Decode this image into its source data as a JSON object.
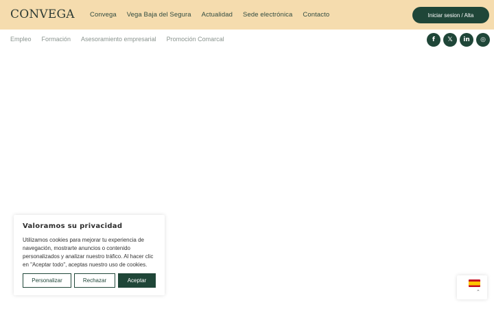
{
  "header": {
    "logo": "CONVEGA",
    "nav": [
      "Convega",
      "Vega Baja del Segura",
      "Actualidad",
      "Sede electrónica",
      "Contacto"
    ],
    "login_label": "Iniciar sesion / Alta"
  },
  "subnav": {
    "items": [
      "Empleo",
      "Formación",
      "Asesoramiento empresarial",
      "Promoción Comarcal"
    ]
  },
  "social": {
    "facebook": "f",
    "x": "𝕏",
    "linkedin": "in",
    "instagram": "◎"
  },
  "cookie": {
    "title": "Valoramos su privacidad",
    "text": "Utilizamos cookies para mejorar tu experiencia de navegación, mostrarte anuncios o contenido personalizados y analizar nuestro tráfico. Al hacer clic en \"Aceptar todo\", aceptas nuestro uso de cookies.",
    "customize_label": "Personalizar",
    "reject_label": "Rechazar",
    "accept_label": "Aceptar"
  },
  "language": {
    "icon": "spain-flag-icon",
    "chevron": "⌃"
  }
}
